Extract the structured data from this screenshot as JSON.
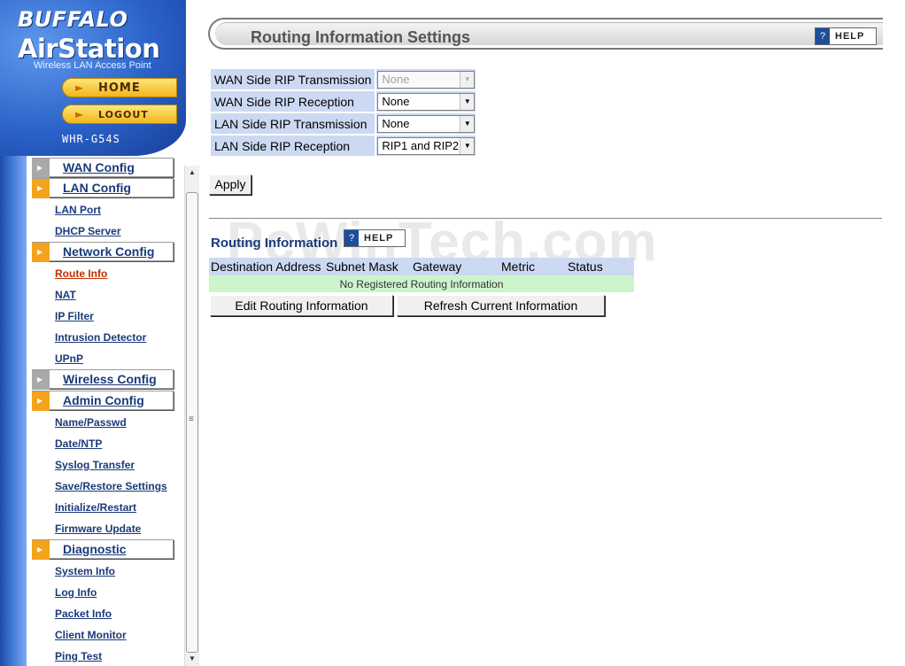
{
  "header": {
    "brand": "BUFFALO",
    "product": "AirStation",
    "tagline": "Wireless LAN Access Point",
    "home_label": "HOME",
    "logout_label": "LOGOUT",
    "model": "WHR-G54S"
  },
  "sidebar": {
    "sections": [
      {
        "label": "WAN Config",
        "icon": "gray"
      },
      {
        "label": "LAN Config",
        "icon": "orange"
      },
      {
        "label": "Network Config",
        "icon": "orange"
      },
      {
        "label": "Wireless Config",
        "icon": "gray"
      },
      {
        "label": "Admin Config",
        "icon": "orange"
      },
      {
        "label": "Diagnostic",
        "icon": "orange"
      }
    ],
    "items": [
      "LAN Port",
      "DHCP Server",
      "Route Info",
      "NAT",
      "IP Filter",
      "Intrusion Detector",
      "UPnP",
      "Name/Passwd",
      "Date/NTP",
      "Syslog Transfer",
      "Save/Restore Settings",
      "Initialize/Restart",
      "Firmware Update",
      "System Info",
      "Log Info",
      "Packet Info",
      "Client Monitor",
      "Ping Test"
    ],
    "active_item": "Route Info"
  },
  "main": {
    "title": "Routing Information Settings",
    "help_label": "HELP",
    "rip_settings": [
      {
        "label": "WAN Side RIP Transmission",
        "value": "None",
        "disabled": true
      },
      {
        "label": "WAN Side RIP Reception",
        "value": "None",
        "disabled": false
      },
      {
        "label": "LAN Side RIP Transmission",
        "value": "None",
        "disabled": false
      },
      {
        "label": "LAN Side RIP Reception",
        "value": "RIP1 and RIP2",
        "disabled": false
      }
    ],
    "apply_label": "Apply",
    "watermark": "PcWinTech.com",
    "routing_info": {
      "heading": "Routing Information",
      "help_label": "HELP",
      "columns": [
        "Destination Address",
        "Subnet Mask",
        "Gateway",
        "Metric",
        "Status"
      ],
      "empty_message": "No Registered Routing Information",
      "edit_label": "Edit Routing Information",
      "refresh_label": "Refresh Current Information"
    }
  },
  "colors": {
    "accent_blue": "#2b62c9",
    "label_bg": "#ccd9f2",
    "empty_row_bg": "#ccf5cc",
    "menu_orange": "#f5a31c"
  }
}
